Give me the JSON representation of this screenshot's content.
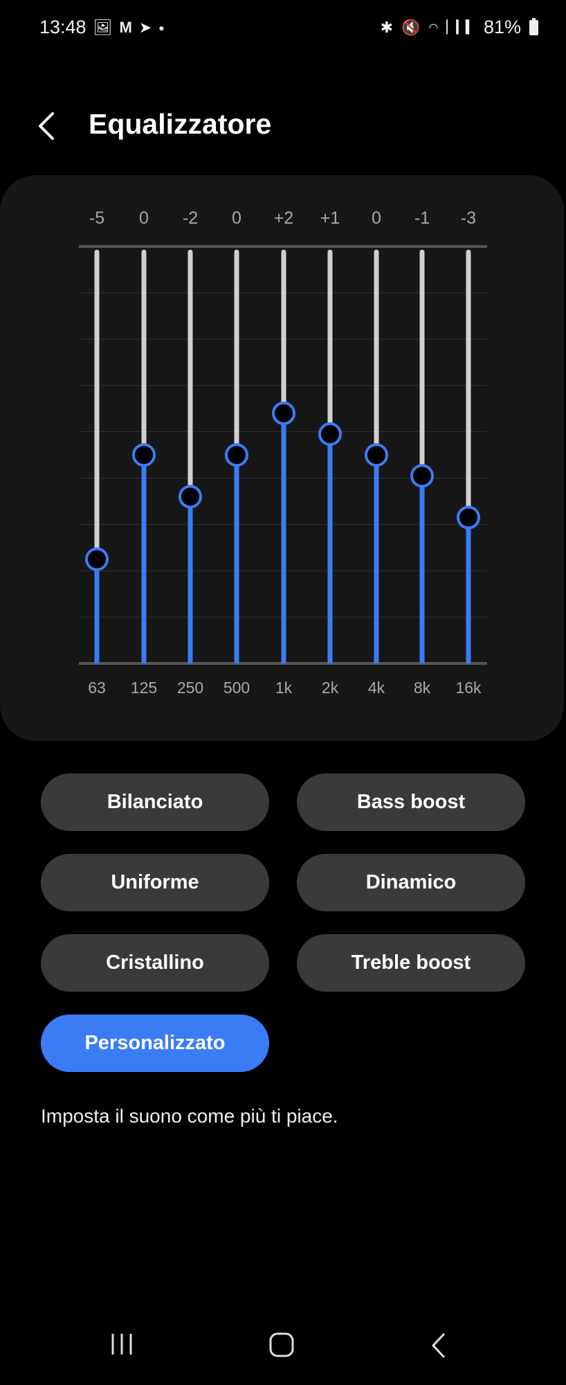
{
  "status_bar": {
    "time": "13:48",
    "left_icons": [
      "gallery-icon",
      "gmail-icon",
      "telegram-icon",
      "dot-icon"
    ],
    "right_icons": [
      "bluetooth-icon",
      "mute-icon",
      "wifi-icon",
      "signal-icon"
    ],
    "battery": "81%"
  },
  "header": {
    "title": "Equalizzatore",
    "back_icon": "chevron-left-icon"
  },
  "chart_data": {
    "type": "bar",
    "categories": [
      "63",
      "125",
      "250",
      "500",
      "1k",
      "2k",
      "4k",
      "8k",
      "16k"
    ],
    "value_labels": [
      "-5",
      "0",
      "-2",
      "0",
      "+2",
      "+1",
      "0",
      "-1",
      "-3"
    ],
    "values": [
      -5,
      0,
      -2,
      0,
      2,
      1,
      0,
      -1,
      -3
    ],
    "ylim": [
      -10,
      10
    ],
    "grid": true,
    "colors": {
      "active": "#3b7cf6",
      "track": "#d0d0d0",
      "grid": "#333333",
      "axis": "#555555"
    }
  },
  "presets": [
    {
      "label": "Bilanciato",
      "active": false
    },
    {
      "label": "Bass boost",
      "active": false
    },
    {
      "label": "Uniforme",
      "active": false
    },
    {
      "label": "Dinamico",
      "active": false
    },
    {
      "label": "Cristallino",
      "active": false
    },
    {
      "label": "Treble boost",
      "active": false
    },
    {
      "label": "Personalizzato",
      "active": true
    }
  ],
  "description": "Imposta il suono come più ti piace.",
  "nav_bar": {
    "icons": [
      "recents-icon",
      "home-icon",
      "back-icon"
    ]
  }
}
